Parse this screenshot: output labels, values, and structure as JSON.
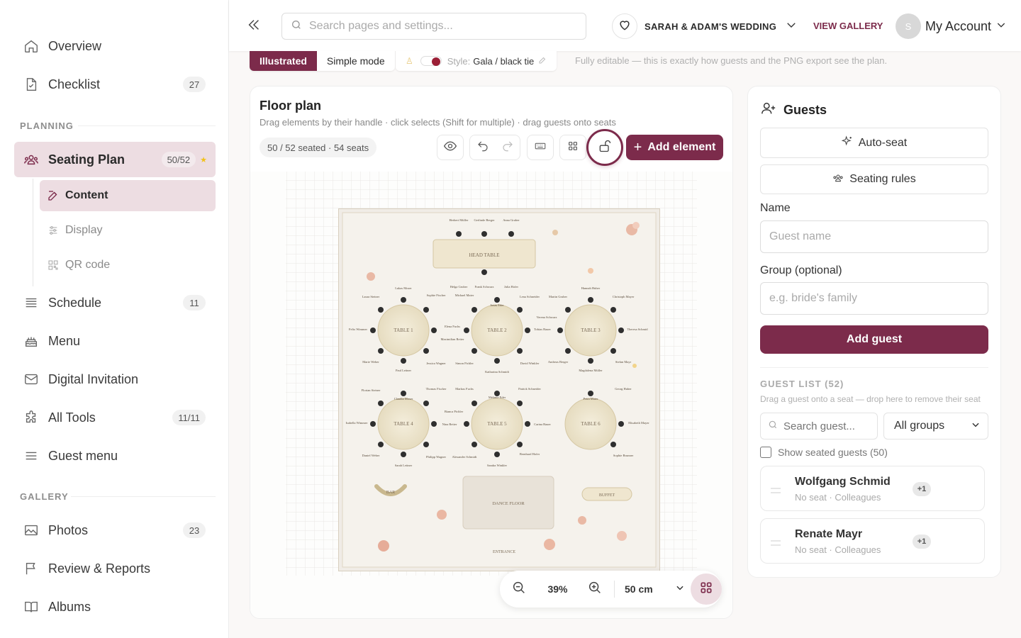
{
  "sidebar": {
    "overview": "Overview",
    "checklist": {
      "label": "Checklist",
      "count": "27"
    },
    "planning_header": "PLANNING",
    "seating": {
      "label": "Seating Plan",
      "count": "50/52"
    },
    "sub": {
      "content": "Content",
      "display": "Display",
      "qr": "QR code"
    },
    "schedule": {
      "label": "Schedule",
      "count": "11"
    },
    "menu": "Menu",
    "invitation": "Digital Invitation",
    "tools": {
      "label": "All Tools",
      "count": "11/11"
    },
    "guest_menu": "Guest menu",
    "gallery_header": "GALLERY",
    "photos": {
      "label": "Photos",
      "count": "23"
    },
    "review": "Review & Reports",
    "albums": "Albums"
  },
  "topbar": {
    "search_placeholder": "Search pages and settings...",
    "event": "SARAH & ADAM'S WEDDING",
    "view_gallery": "VIEW GALLERY",
    "avatar_initial": "S",
    "account": "My Account"
  },
  "modebar": {
    "illustrated": "Illustrated",
    "simple": "Simple mode",
    "style_label": "Style:",
    "style_value": "Gala / black tie",
    "note": "Fully editable — this is exactly how guests and the PNG export see the plan."
  },
  "floorplan": {
    "title": "Floor plan",
    "subtitle": "Drag elements by their handle · click selects (Shift for multiple) · drag guests onto seats",
    "seated": "50 / 52 seated · 54 seats",
    "add_element": "Add element",
    "zoom": "39%",
    "grid_size": "50 cm",
    "labels": {
      "head": "HEAD TABLE",
      "t1": "TABLE 1",
      "t2": "TABLE 2",
      "t3": "TABLE 3",
      "t4": "TABLE 4",
      "t5": "TABLE 5",
      "t6": "TABLE 6",
      "bar": "BAR",
      "buffet": "BUFFET",
      "dance": "DANCE FLOOR",
      "entrance": "ENTRANCE"
    },
    "names": {
      "head_top": [
        "Herbert Müller",
        "Gerlinde Berger",
        "Anna Gruber"
      ],
      "head_bottom": [
        "Helga Gruber",
        "Frank Schwarz",
        "Julia Hofer"
      ],
      "t1": [
        "Lukas Moser",
        "Laura Steiner",
        "Felix Wimmer",
        "Marie Weber",
        "Paul Leitner"
      ],
      "t2": [
        "Sophie Fischer",
        "Michael Maier",
        "Jonas Eder",
        "Elena Fuchs",
        "Maximilian Reiter",
        "Simon Pichler",
        "Katharina Schmidt",
        "David Winkler",
        "Jessica Wagner",
        "Lena Schneider",
        "Verena Schwarz",
        "Tobias Bauer"
      ],
      "t3": [
        "Hannah Huber",
        "Martin Gruber",
        "Christoph Mayer",
        "Theresa Schmid",
        "Stefan Mayr",
        "Magdalena Müller",
        "Andreas Berger"
      ],
      "t4": [
        "Florian Steiner",
        "Claudia Moser",
        "Isabella Wimmer",
        "Daniel Weber",
        "Sarah Leitner"
      ],
      "t5": [
        "Thomas Fischer",
        "Markus Fuchs",
        "Melanie Eder",
        "Bianca Pichler",
        "Nina Reiter",
        "Philipp Wagner",
        "Alexander Schmidt",
        "Sandra Winkler",
        "Patrick Schneider",
        "Carina Bauer",
        "Bernhard Hofer"
      ],
      "t6": [
        "Georg Huber",
        "Petra Maier",
        "Elisabeth Mayer",
        "Sophie Brunner"
      ]
    }
  },
  "guests": {
    "title": "Guests",
    "auto_seat": "Auto-seat",
    "rules": "Seating rules",
    "name_label": "Name",
    "name_placeholder": "Guest name",
    "group_label": "Group (optional)",
    "group_placeholder": "e.g. bride's family",
    "add": "Add guest",
    "list_header": "GUEST LIST (52)",
    "list_hint": "Drag a guest onto a seat — drop here to remove their seat",
    "search_placeholder": "Search guest...",
    "groups": "All groups",
    "show_seated": "Show seated guests (50)",
    "list": [
      {
        "name": "Wolfgang Schmid",
        "meta": "No seat · Colleagues",
        "plus": "+1"
      },
      {
        "name": "Renate Mayr",
        "meta": "No seat · Colleagues",
        "plus": "+1"
      }
    ]
  },
  "colors": {
    "accent": "#7c2b4b",
    "accent_light": "#eddde2"
  }
}
